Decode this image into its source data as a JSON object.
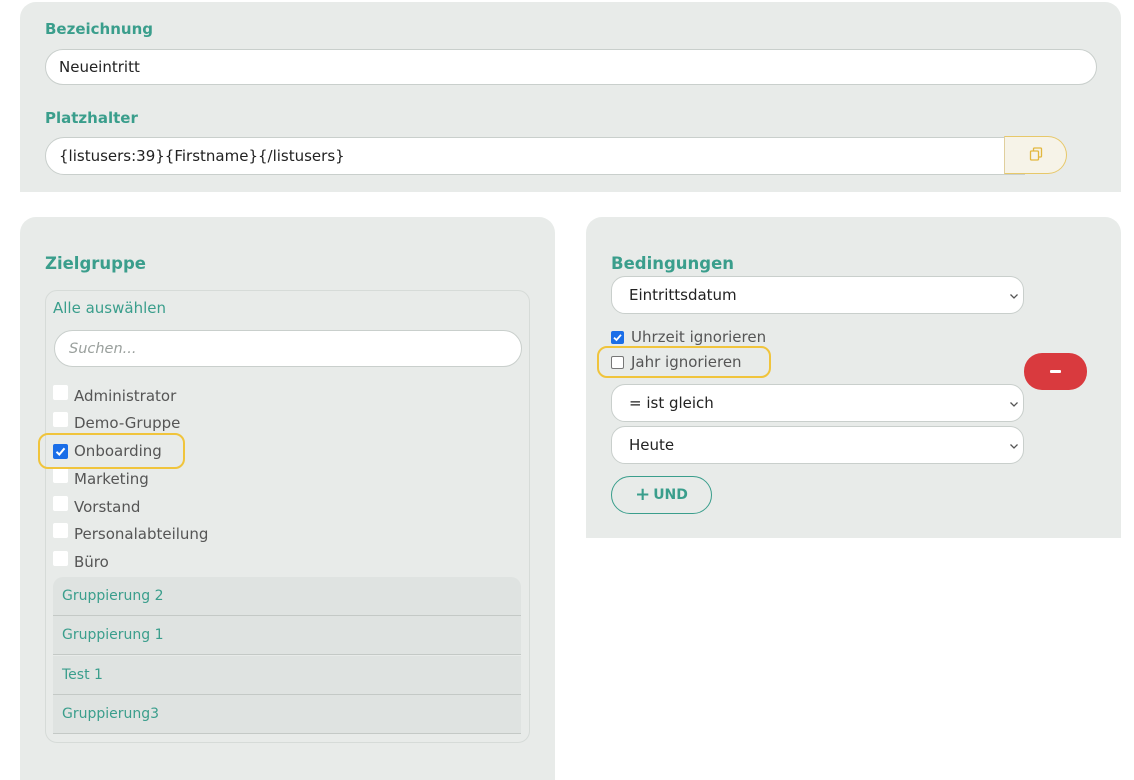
{
  "top": {
    "name_label": "Bezeichnung",
    "name_value": "Neueintritt",
    "placeholder_label": "Platzhalter",
    "placeholder_value": "{listusers:39}{Firstname}{/listusers}"
  },
  "target_group": {
    "title": "Zielgruppe",
    "select_all": "Alle auswählen",
    "search_placeholder": "Suchen...",
    "groups": [
      {
        "label": "Administrator",
        "checked": false
      },
      {
        "label": "Demo-Gruppe",
        "checked": false
      },
      {
        "label": "Onboarding",
        "checked": true
      },
      {
        "label": "Marketing",
        "checked": false
      },
      {
        "label": "Vorstand",
        "checked": false
      },
      {
        "label": "Personalabteilung",
        "checked": false
      },
      {
        "label": "Büro",
        "checked": false
      }
    ],
    "groupings": [
      "Gruppierung 2",
      "Gruppierung 1",
      "Test 1",
      "Gruppierung3"
    ]
  },
  "conditions": {
    "title": "Bedingungen",
    "field_select": "Eintrittsdatum",
    "ignore_time_label": "Uhrzeit ignorieren",
    "ignore_time_checked": true,
    "ignore_year_label": "Jahr ignorieren",
    "ignore_year_checked": false,
    "operator_select": "= ist gleich",
    "value_select": "Heute",
    "and_button": "UND"
  },
  "colors": {
    "accent": "#3a9e8c",
    "panel": "#e8ebe9",
    "highlight": "#f0c43c",
    "danger": "#d93a3e",
    "checkbox": "#1a6ee8"
  }
}
